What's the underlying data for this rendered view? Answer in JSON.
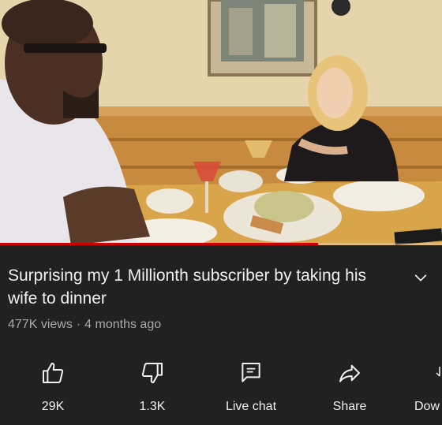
{
  "video": {
    "progress_fraction": 0.72,
    "progress_color": "#cc0000"
  },
  "info": {
    "title": "Surprising my 1 Millionth subscriber by taking his wife to dinner",
    "views": "477K views",
    "separator": "·",
    "age": "4 months ago",
    "expand_icon": "chevron-down-icon"
  },
  "actions": {
    "like": {
      "label": "29K",
      "icon": "thumbs-up-icon"
    },
    "dislike": {
      "label": "1.3K",
      "icon": "thumbs-down-icon"
    },
    "live_chat": {
      "label": "Live chat",
      "icon": "chat-icon"
    },
    "share": {
      "label": "Share",
      "icon": "share-arrow-icon"
    },
    "download": {
      "label": "Dow",
      "icon": "download-icon"
    }
  }
}
